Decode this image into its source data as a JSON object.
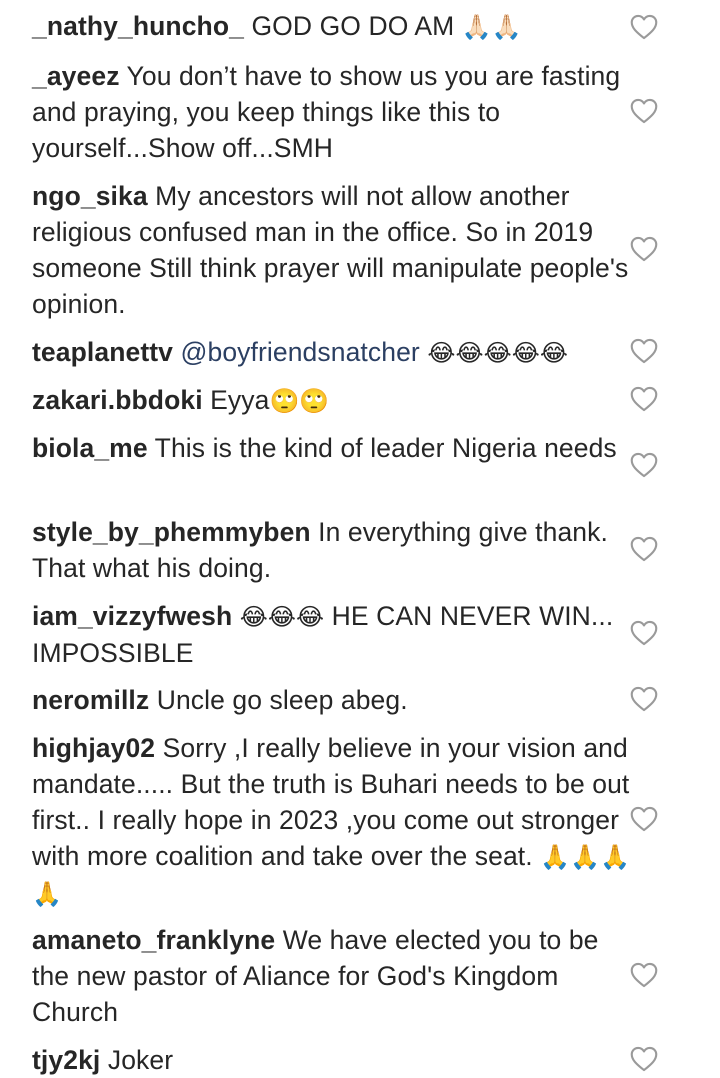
{
  "comments": [
    {
      "username": "_nathy_huncho_",
      "text": "GOD GO DO AM",
      "emoji": "🙏🏻🙏🏻"
    },
    {
      "username": "_ayeez",
      "text": "You don’t have to show us you are fasting and praying, you keep things like this to yourself...Show off...SMH"
    },
    {
      "username": "ngo_sika",
      "text": "My ancestors will not allow another religious confused man in the office. So in 2019 someone Still think prayer will manipulate people's opinion."
    },
    {
      "username": "teaplanettv",
      "mention": "@boyfriendsnatcher",
      "emoji": "😂😂😂😂😂"
    },
    {
      "username": "zakari.bbdoki",
      "text": "Eyya",
      "emoji": "🙄🙄"
    },
    {
      "username": "biola_me",
      "text": "This is the kind of leader Nigeria needs"
    },
    {
      "username": "style_by_phemmyben",
      "text": "In everything give thank. That what his doing."
    },
    {
      "username": "iam_vizzyfwesh",
      "emoji": "😂😂😂",
      "text": "HE CAN NEVER WIN... IMPOSSIBLE"
    },
    {
      "username": "neromillz",
      "text": "Uncle go sleep abeg."
    },
    {
      "username": "highjay02",
      "text": "Sorry ,I really believe in your vision and mandate..... But the truth is Buhari needs to be out first.. I really hope in 2023 ,you come out stronger with more coalition and take over the seat.",
      "emoji": "🙏🙏🙏🙏"
    },
    {
      "username": "amaneto_franklyne",
      "text": "We have elected you to be the new pastor of Aliance for God's Kingdom Church"
    },
    {
      "username": "tjy2kj",
      "text": "Joker"
    }
  ]
}
